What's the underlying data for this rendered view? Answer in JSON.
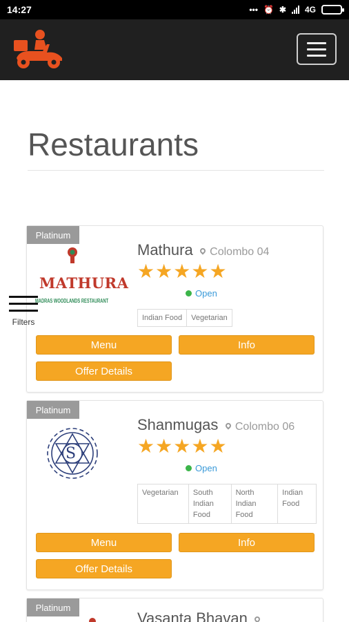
{
  "status_bar": {
    "time": "14:27",
    "network": "4G"
  },
  "page": {
    "title": "Restaurants"
  },
  "filters": {
    "label": "Filters"
  },
  "brand": {
    "accent": "#f5a623",
    "logo_color": "#e8511f"
  },
  "restaurants": [
    {
      "tier": "Platinum",
      "name": "Mathura",
      "location": "Colombo 04",
      "rating": 5,
      "status": "Open",
      "logo_text": "MATHURA",
      "logo_subtext": "MADRAS WOODLANDS RESTAURANT",
      "tags": [
        "Indian Food",
        "Vegetarian"
      ],
      "menu_label": "Menu",
      "info_label": "Info",
      "offer_label": "Offer Details"
    },
    {
      "tier": "Platinum",
      "name": "Shanmugas",
      "location": "Colombo 06",
      "rating": 5,
      "status": "Open",
      "logo_text": "S",
      "tags": [
        "Vegetarian",
        "South Indian Food",
        "North Indian Food",
        "Indian Food"
      ],
      "menu_label": "Menu",
      "info_label": "Info",
      "offer_label": "Offer Details"
    },
    {
      "tier": "Platinum",
      "name": "Vasanta Bhavan"
    }
  ]
}
